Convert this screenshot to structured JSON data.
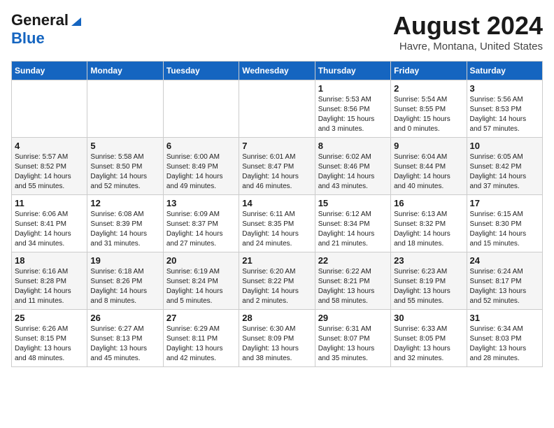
{
  "header": {
    "logo_line1": "General",
    "logo_line2": "Blue",
    "month": "August 2024",
    "location": "Havre, Montana, United States"
  },
  "weekdays": [
    "Sunday",
    "Monday",
    "Tuesday",
    "Wednesday",
    "Thursday",
    "Friday",
    "Saturday"
  ],
  "weeks": [
    [
      {
        "day": "",
        "info": ""
      },
      {
        "day": "",
        "info": ""
      },
      {
        "day": "",
        "info": ""
      },
      {
        "day": "",
        "info": ""
      },
      {
        "day": "1",
        "info": "Sunrise: 5:53 AM\nSunset: 8:56 PM\nDaylight: 15 hours\nand 3 minutes."
      },
      {
        "day": "2",
        "info": "Sunrise: 5:54 AM\nSunset: 8:55 PM\nDaylight: 15 hours\nand 0 minutes."
      },
      {
        "day": "3",
        "info": "Sunrise: 5:56 AM\nSunset: 8:53 PM\nDaylight: 14 hours\nand 57 minutes."
      }
    ],
    [
      {
        "day": "4",
        "info": "Sunrise: 5:57 AM\nSunset: 8:52 PM\nDaylight: 14 hours\nand 55 minutes."
      },
      {
        "day": "5",
        "info": "Sunrise: 5:58 AM\nSunset: 8:50 PM\nDaylight: 14 hours\nand 52 minutes."
      },
      {
        "day": "6",
        "info": "Sunrise: 6:00 AM\nSunset: 8:49 PM\nDaylight: 14 hours\nand 49 minutes."
      },
      {
        "day": "7",
        "info": "Sunrise: 6:01 AM\nSunset: 8:47 PM\nDaylight: 14 hours\nand 46 minutes."
      },
      {
        "day": "8",
        "info": "Sunrise: 6:02 AM\nSunset: 8:46 PM\nDaylight: 14 hours\nand 43 minutes."
      },
      {
        "day": "9",
        "info": "Sunrise: 6:04 AM\nSunset: 8:44 PM\nDaylight: 14 hours\nand 40 minutes."
      },
      {
        "day": "10",
        "info": "Sunrise: 6:05 AM\nSunset: 8:42 PM\nDaylight: 14 hours\nand 37 minutes."
      }
    ],
    [
      {
        "day": "11",
        "info": "Sunrise: 6:06 AM\nSunset: 8:41 PM\nDaylight: 14 hours\nand 34 minutes."
      },
      {
        "day": "12",
        "info": "Sunrise: 6:08 AM\nSunset: 8:39 PM\nDaylight: 14 hours\nand 31 minutes."
      },
      {
        "day": "13",
        "info": "Sunrise: 6:09 AM\nSunset: 8:37 PM\nDaylight: 14 hours\nand 27 minutes."
      },
      {
        "day": "14",
        "info": "Sunrise: 6:11 AM\nSunset: 8:35 PM\nDaylight: 14 hours\nand 24 minutes."
      },
      {
        "day": "15",
        "info": "Sunrise: 6:12 AM\nSunset: 8:34 PM\nDaylight: 14 hours\nand 21 minutes."
      },
      {
        "day": "16",
        "info": "Sunrise: 6:13 AM\nSunset: 8:32 PM\nDaylight: 14 hours\nand 18 minutes."
      },
      {
        "day": "17",
        "info": "Sunrise: 6:15 AM\nSunset: 8:30 PM\nDaylight: 14 hours\nand 15 minutes."
      }
    ],
    [
      {
        "day": "18",
        "info": "Sunrise: 6:16 AM\nSunset: 8:28 PM\nDaylight: 14 hours\nand 11 minutes."
      },
      {
        "day": "19",
        "info": "Sunrise: 6:18 AM\nSunset: 8:26 PM\nDaylight: 14 hours\nand 8 minutes."
      },
      {
        "day": "20",
        "info": "Sunrise: 6:19 AM\nSunset: 8:24 PM\nDaylight: 14 hours\nand 5 minutes."
      },
      {
        "day": "21",
        "info": "Sunrise: 6:20 AM\nSunset: 8:22 PM\nDaylight: 14 hours\nand 2 minutes."
      },
      {
        "day": "22",
        "info": "Sunrise: 6:22 AM\nSunset: 8:21 PM\nDaylight: 13 hours\nand 58 minutes."
      },
      {
        "day": "23",
        "info": "Sunrise: 6:23 AM\nSunset: 8:19 PM\nDaylight: 13 hours\nand 55 minutes."
      },
      {
        "day": "24",
        "info": "Sunrise: 6:24 AM\nSunset: 8:17 PM\nDaylight: 13 hours\nand 52 minutes."
      }
    ],
    [
      {
        "day": "25",
        "info": "Sunrise: 6:26 AM\nSunset: 8:15 PM\nDaylight: 13 hours\nand 48 minutes."
      },
      {
        "day": "26",
        "info": "Sunrise: 6:27 AM\nSunset: 8:13 PM\nDaylight: 13 hours\nand 45 minutes."
      },
      {
        "day": "27",
        "info": "Sunrise: 6:29 AM\nSunset: 8:11 PM\nDaylight: 13 hours\nand 42 minutes."
      },
      {
        "day": "28",
        "info": "Sunrise: 6:30 AM\nSunset: 8:09 PM\nDaylight: 13 hours\nand 38 minutes."
      },
      {
        "day": "29",
        "info": "Sunrise: 6:31 AM\nSunset: 8:07 PM\nDaylight: 13 hours\nand 35 minutes."
      },
      {
        "day": "30",
        "info": "Sunrise: 6:33 AM\nSunset: 8:05 PM\nDaylight: 13 hours\nand 32 minutes."
      },
      {
        "day": "31",
        "info": "Sunrise: 6:34 AM\nSunset: 8:03 PM\nDaylight: 13 hours\nand 28 minutes."
      }
    ]
  ]
}
